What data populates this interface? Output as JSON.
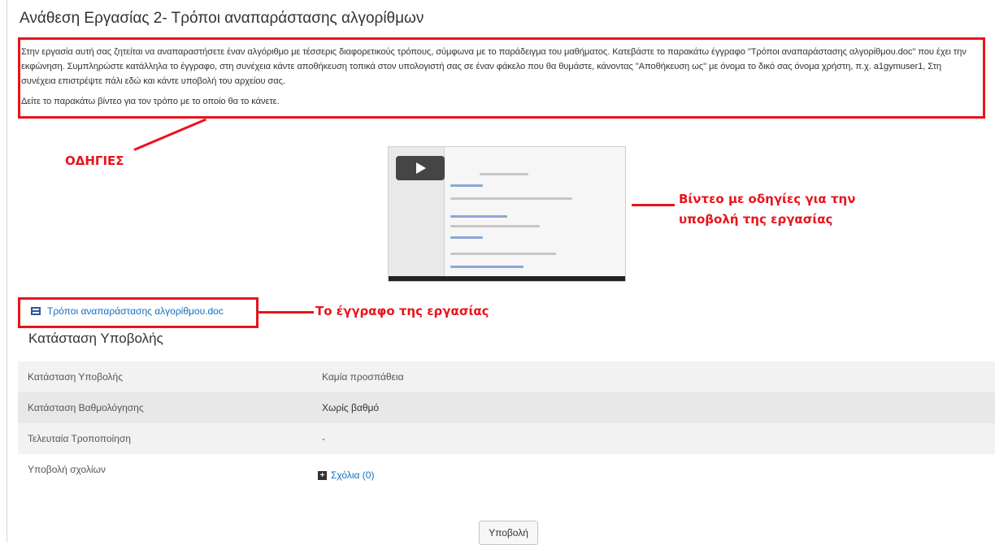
{
  "assignment": {
    "title": "Ανάθεση Εργασίας 2- Τρόποι αναπαράστασης αλγορίθμων",
    "paragraph1": "Στην εργασία αυτή σας ζητείται να αναπαραστήσετε έναν αλγόριθμο με τέσσερις διαφορετικούς τρόπους, σύμφωνα με το παράδειγμα του μαθήματος. Κατεβάστε το παρακάτω έγγραφο \"Τρόποι αναπαράστασης αλγορίθμου.doc\" που έχει την εκφώνηση. Συμπληρώστε κατάλληλα το έγγραφο, στη συνέχεια κάντε αποθήκευση τοπικά στον υπολογιστή σας σε έναν φάκελο που θα θυμάστε, κάνοντας \"Αποθήκευση ως\" με όνομα το δικό σας όνομα χρήστη, π.χ. a1gymuser1, Στη συνέχεια επιστρέψτε πάλι εδώ και κάντε υποβολή του αρχείου σας.",
    "paragraph2": "Δείτε το παρακάτω βίντεο για τον τρόπο με το οποίο θα το κάνετε.",
    "document_link": "Τρόποι αναπαράστασης αλγορίθμου.doc"
  },
  "annotations": {
    "instructions": "ΟΔΗΓΙΕΣ",
    "video_line1": "Βίντεο με οδηγίες για την",
    "video_line2": "υποβολή της εργασίας",
    "document": "Το έγγραφο της εργασίας"
  },
  "submission_status": {
    "heading": "Κατάσταση Υποβολής",
    "rows": [
      {
        "label": "Κατάσταση Υποβολής",
        "value": "Καμία προσπάθεια"
      },
      {
        "label": "Κατάσταση Βαθμολόγησης",
        "value": "Χωρίς βαθμό"
      },
      {
        "label": "Τελευταία Τροποποίηση",
        "value": "-"
      },
      {
        "label": "Υποβολή σχολίων",
        "value": ""
      }
    ],
    "comments_link": "Σχόλια (0)",
    "submit_label": "Υποβολή"
  },
  "colors": {
    "annotation_red": "#e8141b",
    "link_blue": "#0f6fc5"
  },
  "icons": [
    "play-icon",
    "word-document-icon",
    "plus-icon"
  ]
}
